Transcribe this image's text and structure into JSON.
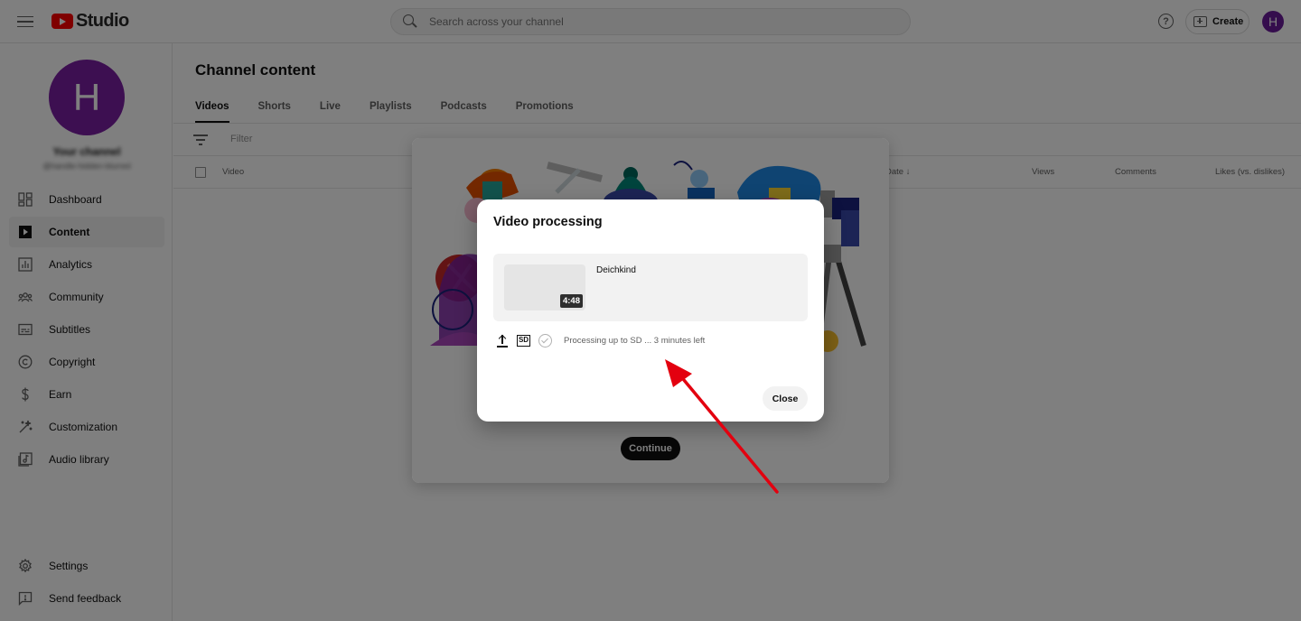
{
  "header": {
    "logo_text": "Studio",
    "search_placeholder": "Search across your channel",
    "help_label": "?",
    "create_label": "Create",
    "avatar_letter": "H"
  },
  "sidebar": {
    "channel_avatar_letter": "H",
    "channel_name": "Your channel",
    "channel_handle": "@handle-hidden-blurred",
    "items": [
      {
        "label": "Dashboard",
        "icon": "dashboard-icon"
      },
      {
        "label": "Content",
        "icon": "content-icon",
        "active": true
      },
      {
        "label": "Analytics",
        "icon": "analytics-icon"
      },
      {
        "label": "Community",
        "icon": "community-icon"
      },
      {
        "label": "Subtitles",
        "icon": "subtitles-icon"
      },
      {
        "label": "Copyright",
        "icon": "copyright-icon"
      },
      {
        "label": "Earn",
        "icon": "earn-icon"
      },
      {
        "label": "Customization",
        "icon": "customization-icon"
      },
      {
        "label": "Audio library",
        "icon": "audio-library-icon"
      }
    ],
    "bottom_items": [
      {
        "label": "Settings",
        "icon": "gear-icon"
      },
      {
        "label": "Send feedback",
        "icon": "feedback-icon"
      }
    ]
  },
  "main": {
    "title": "Channel content",
    "tabs": [
      "Videos",
      "Shorts",
      "Live",
      "Playlists",
      "Podcasts",
      "Promotions"
    ],
    "filter_placeholder": "Filter",
    "columns": [
      "Video",
      "Date",
      "Views",
      "Comments",
      "Likes (vs. dislikes)"
    ]
  },
  "background_dialog": {
    "continue_label": "Continue"
  },
  "dialog": {
    "title": "Video processing",
    "video_title": "Deichkind",
    "duration": "4:48",
    "sd_badge": "SD",
    "status_text": "Processing up to SD ... 3 minutes left",
    "close_label": "Close"
  },
  "colors": {
    "brand_red": "#ff0000",
    "avatar_purple": "#7b1fa2",
    "annotation_arrow": "#e3000f"
  }
}
